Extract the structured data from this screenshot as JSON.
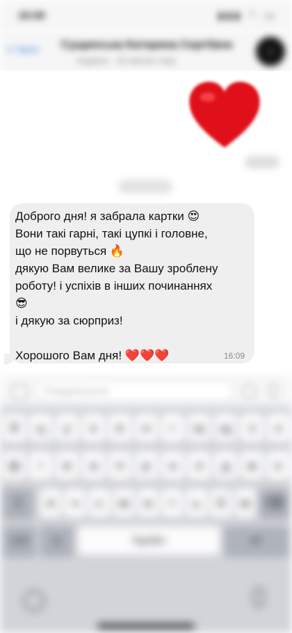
{
  "status_bar": {
    "time": "16:09",
    "icons": "▮▮▮ ◠ ▭"
  },
  "header": {
    "back_label": "Чати",
    "title": "Сущинська Катерина Сергіївна",
    "subtitle": "недавно · 18 хвилин тому"
  },
  "message": {
    "text": "Доброго дня! я забрала картки 😍\nВони такі гарні, такі цупкі і головне,\nщо не порвуться 🔥\nдякую Вам велике за Вашу зроблену\nроботу! і успіхів в інших починаннях\n😎\nі дякую за сюрприз!\n\nХорошого Вам дня! ❤️❤️❤️",
    "time": "16:09"
  },
  "composer": {
    "placeholder": "Повідомлення"
  },
  "keyboard": {
    "row1": [
      "й",
      "ц",
      "у",
      "к",
      "е",
      "н",
      "г",
      "ш",
      "щ",
      "з",
      "х"
    ],
    "row2": [
      "ф",
      "і",
      "в",
      "а",
      "п",
      "р",
      "о",
      "л",
      "д",
      "ж",
      "є"
    ],
    "row3": [
      "я",
      "ч",
      "с",
      "м",
      "и",
      "т",
      "ь",
      "б",
      "ю"
    ],
    "space_label": "Пробіл",
    "shift_icon": "⇧",
    "backspace_icon": "⌫",
    "numbers_label": "123",
    "emoji_icon": "☺",
    "return_icon": "↵"
  },
  "colors": {
    "accent": "#2f7fe6",
    "heart": "#e0101a"
  }
}
